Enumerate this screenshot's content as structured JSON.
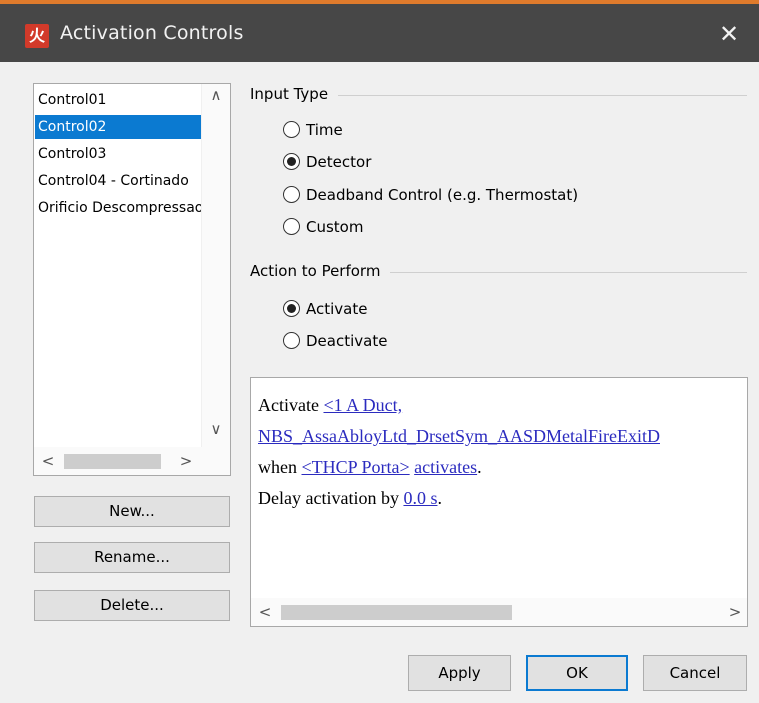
{
  "window": {
    "title": "Activation Controls",
    "app_icon": "火",
    "close_glyph": "✕"
  },
  "controls_list": {
    "items": [
      {
        "label": "Control01"
      },
      {
        "label": "Control02",
        "selected": true
      },
      {
        "label": "Control03"
      },
      {
        "label": "Control04 - Cortinado"
      },
      {
        "label": "Orificio Descompressao"
      }
    ],
    "scroll_up": "∧",
    "scroll_down": "∨",
    "scroll_left": "<",
    "scroll_right": ">"
  },
  "list_buttons": {
    "new": "New...",
    "rename": "Rename...",
    "delete": "Delete..."
  },
  "input_type": {
    "label": "Input Type",
    "options": [
      {
        "label": "Time",
        "checked": false
      },
      {
        "label": "Detector",
        "checked": true
      },
      {
        "label": "Deadband Control (e.g. Thermostat)",
        "checked": false
      },
      {
        "label": "Custom",
        "checked": false
      }
    ]
  },
  "action": {
    "label": "Action to Perform",
    "options": [
      {
        "label": "Activate",
        "checked": true
      },
      {
        "label": "Deactivate",
        "checked": false
      }
    ]
  },
  "description": {
    "line1_prefix": "Activate ",
    "line1_link": "<1 A Duct,",
    "line2_link": "NBS_AssaAbloyLtd_DrsetSym_AASDMetalFireExitD",
    "line3_prefix": "when ",
    "line3_link1": "<THCP Porta>",
    "line3_space": " ",
    "line3_link2": "activates",
    "line3_suffix": ".",
    "line4_prefix": "Delay activation by ",
    "line4_link": "0.0 s",
    "line4_suffix": ".",
    "scroll_left": "<",
    "scroll_right": ">"
  },
  "footer_buttons": {
    "apply": "Apply",
    "ok": "OK",
    "cancel": "Cancel"
  },
  "colors": {
    "title_bar": "#474747",
    "accent_top": "#e07b2c",
    "selection": "#0b7ad1",
    "link": "#2b2bbf"
  }
}
